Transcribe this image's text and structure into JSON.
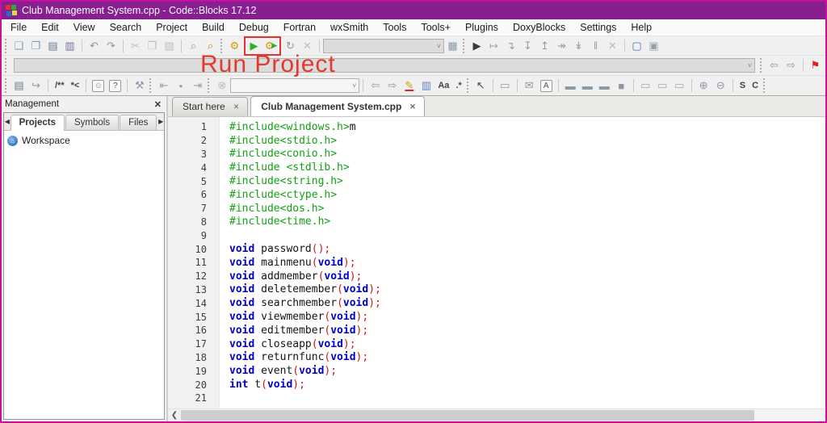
{
  "window": {
    "title": "Club Management System.cpp - Code::Blocks 17.12",
    "titlebar_color": "#871f90",
    "border_color": "#c4109c"
  },
  "menu": {
    "items": [
      "File",
      "Edit",
      "View",
      "Search",
      "Project",
      "Build",
      "Debug",
      "Fortran",
      "wxSmith",
      "Tools",
      "Tools+",
      "Plugins",
      "DoxyBlocks",
      "Settings",
      "Help"
    ]
  },
  "annotation": {
    "text": "Run Project",
    "color": "#e23a2e"
  },
  "toolbar_main": {
    "items": [
      {
        "type": "grip",
        "name": "toolbar-grip"
      },
      {
        "type": "button",
        "name": "new-file-button",
        "glyph": "❏",
        "color": "#7d9bb5"
      },
      {
        "type": "button",
        "name": "open-file-button",
        "glyph": "❐",
        "color": "#7d9bb5"
      },
      {
        "type": "button",
        "name": "save-button",
        "glyph": "▤",
        "color": "#6e7b8a"
      },
      {
        "type": "button",
        "name": "save-all-button",
        "glyph": "▥",
        "color": "#7a6ea0"
      },
      {
        "type": "sep"
      },
      {
        "type": "button",
        "name": "undo-button",
        "glyph": "↶",
        "color": "#8b98a8"
      },
      {
        "type": "button",
        "name": "redo-button",
        "glyph": "↷",
        "color": "#8b98a8"
      },
      {
        "type": "sep"
      },
      {
        "type": "button",
        "name": "cut-button",
        "glyph": "✂",
        "disabled": true
      },
      {
        "type": "button",
        "name": "copy-button",
        "glyph": "❒",
        "disabled": true
      },
      {
        "type": "button",
        "name": "paste-button",
        "glyph": "▨",
        "disabled": true
      },
      {
        "type": "sep"
      },
      {
        "type": "button",
        "name": "find-button",
        "glyph": "⌕",
        "color": "#8b98a8"
      },
      {
        "type": "button",
        "name": "replace-button",
        "glyph": "⌕",
        "color": "#c2862a"
      },
      {
        "type": "grip",
        "name": "toolbar-grip"
      },
      {
        "type": "button",
        "name": "build-button",
        "glyph": "⚙",
        "color": "#d79b00"
      },
      {
        "type": "button",
        "name": "run-button",
        "glyph": "▶",
        "color": "#28b428",
        "box": true
      },
      {
        "type": "button",
        "name": "build-and-run-button",
        "glyph": "⚙",
        "color": "#d79b00",
        "glyph2": "▶",
        "color2": "#28b428",
        "box": true
      },
      {
        "type": "button",
        "name": "rebuild-button",
        "glyph": "↻",
        "color": "#8b98a8"
      },
      {
        "type": "button",
        "name": "abort-build-button",
        "glyph": "✕",
        "disabled": true
      },
      {
        "type": "sep"
      },
      {
        "type": "combo",
        "name": "build-target-combo",
        "width": 150,
        "value": ""
      },
      {
        "type": "button",
        "name": "build-log-icon",
        "glyph": "▦",
        "color": "#8b98a8"
      },
      {
        "type": "grip",
        "name": "toolbar-grip"
      },
      {
        "type": "button",
        "name": "debug-continue-button",
        "glyph": "▶",
        "color": "#3a3a3a"
      },
      {
        "type": "button",
        "name": "run-to-cursor-button",
        "glyph": "↦",
        "color": "#9aa0a8"
      },
      {
        "type": "button",
        "name": "next-line-button",
        "glyph": "↴",
        "color": "#9aa0a8"
      },
      {
        "type": "button",
        "name": "step-into-button",
        "glyph": "↧",
        "color": "#9aa0a8"
      },
      {
        "type": "button",
        "name": "step-out-button",
        "glyph": "↥",
        "color": "#9aa0a8"
      },
      {
        "type": "button",
        "name": "next-instruction-button",
        "glyph": "↠",
        "color": "#9aa0a8"
      },
      {
        "type": "button",
        "name": "step-into-instruction-button",
        "glyph": "↡",
        "color": "#9aa0a8"
      },
      {
        "type": "button",
        "name": "debug-pause-button",
        "glyph": "‖",
        "color": "#9aa0a8"
      },
      {
        "type": "button",
        "name": "debug-stop-button",
        "glyph": "✕",
        "disabled": true
      },
      {
        "type": "sep"
      },
      {
        "type": "button",
        "name": "debugging-windows-icon",
        "glyph": "▢",
        "color": "#3a6fd0"
      },
      {
        "type": "button",
        "name": "memory-dump-icon",
        "glyph": "▣",
        "color": "#9aa0a8"
      }
    ]
  },
  "toolbar_nav": {
    "items": [
      {
        "type": "grip",
        "name": "toolbar-grip"
      },
      {
        "type": "combo",
        "name": "code-completion-scope-combo",
        "flex": true,
        "value": ""
      },
      {
        "type": "grip",
        "name": "toolbar-grip"
      },
      {
        "type": "button",
        "name": "browse-back-button",
        "glyph": "⇦",
        "color": "#8b98a8"
      },
      {
        "type": "button",
        "name": "browse-forward-button",
        "glyph": "⇨",
        "color": "#8b98a8"
      },
      {
        "type": "sep"
      },
      {
        "type": "button",
        "name": "bookmark-flag-icon",
        "glyph": "⚑",
        "color": "#e02020"
      }
    ]
  },
  "toolbar_misc": {
    "items": [
      {
        "type": "grip",
        "name": "toolbar-grip"
      },
      {
        "type": "button",
        "name": "doxy-extract-docs-button",
        "glyph": "▤",
        "color": "#6e7b8a"
      },
      {
        "type": "button",
        "name": "doxy-run-html-button",
        "glyph": "↪",
        "color": "#8b98a8"
      },
      {
        "type": "sep"
      },
      {
        "type": "text",
        "name": "doxy-block-comment-button",
        "glyph": "/**"
      },
      {
        "type": "text",
        "name": "doxy-line-comment-button",
        "glyph": "*<"
      },
      {
        "type": "sep"
      },
      {
        "type": "button",
        "name": "doxy-smiley-icon",
        "glyph": "☺",
        "boxedglyph": true,
        "color": "#8b8b8b"
      },
      {
        "type": "button",
        "name": "doxy-help-button",
        "glyph": "?",
        "boxedglyph": true,
        "color": "#555555"
      },
      {
        "type": "sep"
      },
      {
        "type": "button",
        "name": "doxy-settings-wrench-button",
        "glyph": "⚒",
        "color": "#8b98a8"
      },
      {
        "type": "grip",
        "name": "toolbar-grip"
      },
      {
        "type": "button",
        "name": "jump-back-button",
        "glyph": "⇤",
        "color": "#9aa0a8"
      },
      {
        "type": "button",
        "name": "jump-marker-icon",
        "glyph": "•",
        "color": "#9aa0a8"
      },
      {
        "type": "button",
        "name": "jump-forward-button",
        "glyph": "⇥",
        "color": "#9aa0a8"
      },
      {
        "type": "grip",
        "name": "toolbar-grip"
      },
      {
        "type": "button",
        "name": "clear-search-button",
        "glyph": "⊗",
        "disabled": true
      },
      {
        "type": "combo",
        "name": "incremental-search-combo",
        "width": 160,
        "lite": true,
        "value": ""
      },
      {
        "type": "sep"
      },
      {
        "type": "button",
        "name": "search-prev-button",
        "glyph": "⇦",
        "color": "#8b98a8"
      },
      {
        "type": "button",
        "name": "search-next-button",
        "glyph": "⇨",
        "color": "#8b98a8"
      },
      {
        "type": "button",
        "name": "highlight-occurrences-button",
        "glyph": "✎",
        "color": "#d1a000",
        "underline": true
      },
      {
        "type": "button",
        "name": "search-selection-only-button",
        "glyph": "▥",
        "color": "#5b82c9"
      },
      {
        "type": "text",
        "name": "match-case-button",
        "glyph": "Aa"
      },
      {
        "type": "text",
        "name": "regex-button",
        "glyph": ".*"
      },
      {
        "type": "grip",
        "name": "toolbar-grip"
      },
      {
        "type": "button",
        "name": "wxsmith-pointer-button",
        "glyph": "↖",
        "color": "#444444"
      },
      {
        "type": "sep"
      },
      {
        "type": "button",
        "name": "wxsmith-frame-button",
        "glyph": "▭",
        "color": "#8b98a8"
      },
      {
        "type": "sep"
      },
      {
        "type": "button",
        "name": "wxsmith-envelope-button",
        "glyph": "✉",
        "color": "#8b98a8"
      },
      {
        "type": "button",
        "name": "wxsmith-text-button",
        "glyph": "A",
        "boxedglyph": true,
        "color": "#555555"
      },
      {
        "type": "sep"
      },
      {
        "type": "button",
        "name": "wxsmith-sizer-h-button",
        "glyph": "▬",
        "color": "#8b98a8"
      },
      {
        "type": "button",
        "name": "wxsmith-sizer-v-button",
        "glyph": "▬",
        "color": "#8b98a8"
      },
      {
        "type": "button",
        "name": "wxsmith-sizer-grid-button",
        "glyph": "▬",
        "color": "#8b98a8"
      },
      {
        "type": "button",
        "name": "wxsmith-panel-button",
        "glyph": "■",
        "color": "#8b98a8"
      },
      {
        "type": "sep"
      },
      {
        "type": "button",
        "name": "wxsmith-border-left-button",
        "glyph": "▭",
        "color": "#a9a9a9"
      },
      {
        "type": "button",
        "name": "wxsmith-border-right-button",
        "glyph": "▭",
        "color": "#a9a9a9"
      },
      {
        "type": "button",
        "name": "wxsmith-border-all-button",
        "glyph": "▭",
        "color": "#a9a9a9"
      },
      {
        "type": "sep"
      },
      {
        "type": "button",
        "name": "zoom-in-button",
        "glyph": "⊕",
        "color": "#8b98a8"
      },
      {
        "type": "button",
        "name": "zoom-out-button",
        "glyph": "⊖",
        "color": "#8b98a8"
      },
      {
        "type": "sep"
      },
      {
        "type": "text",
        "name": "wxsmith-source-button",
        "glyph": "S"
      },
      {
        "type": "text",
        "name": "wxsmith-content-button",
        "glyph": "C"
      },
      {
        "type": "grip",
        "name": "toolbar-grip"
      }
    ]
  },
  "management": {
    "title": "Management",
    "close_glyph": "✕",
    "scroll_left_glyph": "◀",
    "scroll_right_glyph": "▶",
    "tabs": [
      {
        "label": "Projects",
        "active": true
      },
      {
        "label": "Symbols",
        "active": false
      },
      {
        "label": "Files",
        "active": false
      }
    ],
    "workspace_label": "Workspace",
    "workspace_icon_glyph": "⌂"
  },
  "editor": {
    "tabs": [
      {
        "label": "Start here",
        "active": false
      },
      {
        "label": "Club Management System.cpp",
        "active": true
      }
    ],
    "tab_close_glyph": "✕",
    "hscroll_left_glyph": "❮"
  },
  "code": {
    "lines": [
      {
        "n": 1,
        "segs": [
          {
            "c": "pp",
            "t": "#include<windows.h>"
          },
          {
            "c": "pl",
            "t": "m"
          }
        ]
      },
      {
        "n": 2,
        "segs": [
          {
            "c": "pp",
            "t": "#include<stdio.h>"
          }
        ]
      },
      {
        "n": 3,
        "segs": [
          {
            "c": "pp",
            "t": "#include<conio.h>"
          }
        ]
      },
      {
        "n": 4,
        "segs": [
          {
            "c": "pp",
            "t": "#include <stdlib.h>"
          }
        ]
      },
      {
        "n": 5,
        "segs": [
          {
            "c": "pp",
            "t": "#include<string.h>"
          }
        ]
      },
      {
        "n": 6,
        "segs": [
          {
            "c": "pp",
            "t": "#include<ctype.h>"
          }
        ]
      },
      {
        "n": 7,
        "segs": [
          {
            "c": "pp",
            "t": "#include<dos.h>"
          }
        ]
      },
      {
        "n": 8,
        "segs": [
          {
            "c": "pp",
            "t": "#include<time.h>"
          }
        ]
      },
      {
        "n": 9,
        "segs": []
      },
      {
        "n": 10,
        "segs": [
          {
            "c": "kw",
            "t": "void"
          },
          {
            "c": "pl",
            "t": " password"
          },
          {
            "c": "pu",
            "t": "();"
          }
        ]
      },
      {
        "n": 11,
        "segs": [
          {
            "c": "kw",
            "t": "void"
          },
          {
            "c": "pl",
            "t": " mainmenu"
          },
          {
            "c": "pu",
            "t": "("
          },
          {
            "c": "kw",
            "t": "void"
          },
          {
            "c": "pu",
            "t": ");"
          }
        ]
      },
      {
        "n": 12,
        "segs": [
          {
            "c": "kw",
            "t": "void"
          },
          {
            "c": "pl",
            "t": " addmember"
          },
          {
            "c": "pu",
            "t": "("
          },
          {
            "c": "kw",
            "t": "void"
          },
          {
            "c": "pu",
            "t": ");"
          }
        ]
      },
      {
        "n": 13,
        "segs": [
          {
            "c": "kw",
            "t": "void"
          },
          {
            "c": "pl",
            "t": " deletemember"
          },
          {
            "c": "pu",
            "t": "("
          },
          {
            "c": "kw",
            "t": "void"
          },
          {
            "c": "pu",
            "t": ");"
          }
        ]
      },
      {
        "n": 14,
        "segs": [
          {
            "c": "kw",
            "t": "void"
          },
          {
            "c": "pl",
            "t": " searchmember"
          },
          {
            "c": "pu",
            "t": "("
          },
          {
            "c": "kw",
            "t": "void"
          },
          {
            "c": "pu",
            "t": ");"
          }
        ]
      },
      {
        "n": 15,
        "segs": [
          {
            "c": "kw",
            "t": "void"
          },
          {
            "c": "pl",
            "t": " viewmember"
          },
          {
            "c": "pu",
            "t": "("
          },
          {
            "c": "kw",
            "t": "void"
          },
          {
            "c": "pu",
            "t": ");"
          }
        ]
      },
      {
        "n": 16,
        "segs": [
          {
            "c": "kw",
            "t": "void"
          },
          {
            "c": "pl",
            "t": " editmember"
          },
          {
            "c": "pu",
            "t": "("
          },
          {
            "c": "kw",
            "t": "void"
          },
          {
            "c": "pu",
            "t": ");"
          }
        ]
      },
      {
        "n": 17,
        "segs": [
          {
            "c": "kw",
            "t": "void"
          },
          {
            "c": "pl",
            "t": " closeapp"
          },
          {
            "c": "pu",
            "t": "("
          },
          {
            "c": "kw",
            "t": "void"
          },
          {
            "c": "pu",
            "t": ");"
          }
        ]
      },
      {
        "n": 18,
        "segs": [
          {
            "c": "kw",
            "t": "void"
          },
          {
            "c": "pl",
            "t": " returnfunc"
          },
          {
            "c": "pu",
            "t": "("
          },
          {
            "c": "kw",
            "t": "void"
          },
          {
            "c": "pu",
            "t": ");"
          }
        ]
      },
      {
        "n": 19,
        "segs": [
          {
            "c": "kw",
            "t": "void"
          },
          {
            "c": "pl",
            "t": " event"
          },
          {
            "c": "pu",
            "t": "("
          },
          {
            "c": "kw",
            "t": "void"
          },
          {
            "c": "pu",
            "t": ");"
          }
        ]
      },
      {
        "n": 20,
        "segs": [
          {
            "c": "kw",
            "t": "int"
          },
          {
            "c": "pl",
            "t": " t"
          },
          {
            "c": "pu",
            "t": "("
          },
          {
            "c": "kw",
            "t": "void"
          },
          {
            "c": "pu",
            "t": ");"
          }
        ]
      },
      {
        "n": 21,
        "segs": []
      }
    ]
  },
  "ui": {
    "combo_chevron": "˅"
  }
}
